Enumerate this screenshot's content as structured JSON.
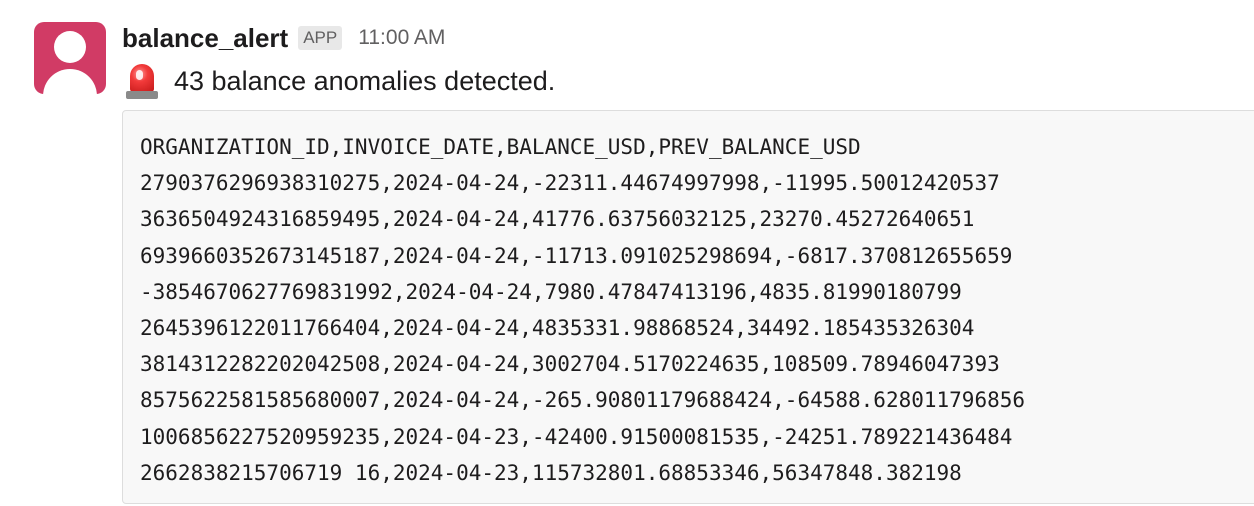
{
  "message": {
    "sender": "balance_alert",
    "badge": "APP",
    "timestamp": "11:00 AM",
    "icon": "rotating-light-icon",
    "text": "43 balance anomalies detected.",
    "code_lines": [
      "ORGANIZATION_ID,INVOICE_DATE,BALANCE_USD,PREV_BALANCE_USD",
      "2790376296938310275,2024-04-24,-22311.44674997998,-11995.50012420537",
      "3636504924316859495,2024-04-24,41776.63756032125,23270.45272640651",
      "6939660352673145187,2024-04-24,-11713.091025298694,-6817.370812655659",
      "-3854670627769831992,2024-04-24,7980.47847413196,4835.81990180799",
      "2645396122011766404,2024-04-24,4835331.98868524,34492.185435326304",
      "3814312282202042508,2024-04-24,3002704.5170224635,108509.78946047393",
      "8575622581585680007,2024-04-24,-265.90801179688424,-64588.628011796856",
      "1006856227520959235,2024-04-23,-42400.91500081535,-24251.789221436484",
      "2662838215706719 16,2024-04-23,115732801.68853346,56347848.382198"
    ]
  }
}
